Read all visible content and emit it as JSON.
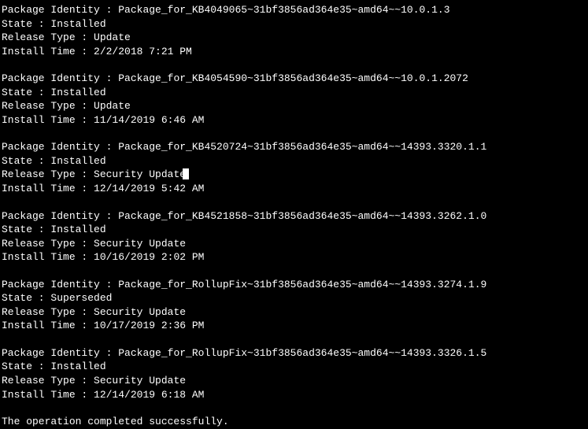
{
  "labels": {
    "package_identity": "Package Identity : ",
    "state": "State : ",
    "release_type": "Release Type : ",
    "install_time": "Install Time : "
  },
  "packages": [
    {
      "identity": "Package_for_KB4049065~31bf3856ad364e35~amd64~~10.0.1.3",
      "state": "Installed",
      "release_type": "Update",
      "install_time": "2/2/2018 7:21 PM"
    },
    {
      "identity": "Package_for_KB4054590~31bf3856ad364e35~amd64~~10.0.1.2072",
      "state": "Installed",
      "release_type": "Update",
      "install_time": "11/14/2019 6:46 AM"
    },
    {
      "identity": "Package_for_KB4520724~31bf3856ad364e35~amd64~~14393.3320.1.1",
      "state": "Installed",
      "release_type": "Security Update",
      "install_time": "12/14/2019 5:42 AM"
    },
    {
      "identity": "Package_for_KB4521858~31bf3856ad364e35~amd64~~14393.3262.1.0",
      "state": "Installed",
      "release_type": "Security Update",
      "install_time": "10/16/2019 2:02 PM"
    },
    {
      "identity": "Package_for_RollupFix~31bf3856ad364e35~amd64~~14393.3274.1.9",
      "state": "Superseded",
      "release_type": "Security Update",
      "install_time": "10/17/2019 2:36 PM"
    },
    {
      "identity": "Package_for_RollupFix~31bf3856ad364e35~amd64~~14393.3326.1.5",
      "state": "Installed",
      "release_type": "Security Update",
      "install_time": "12/14/2019 6:18 AM"
    }
  ],
  "footer": "The operation completed successfully."
}
